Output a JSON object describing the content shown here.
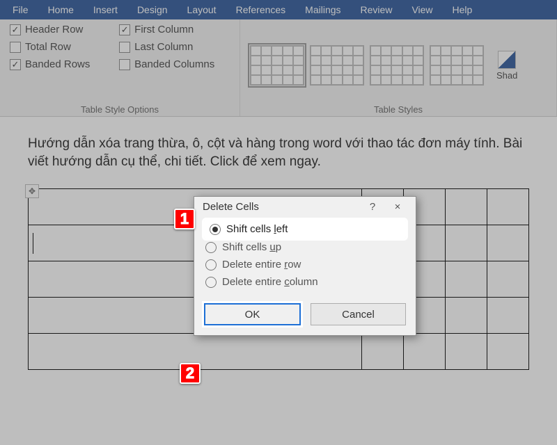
{
  "menu": {
    "file": "File",
    "home": "Home",
    "insert": "Insert",
    "design": "Design",
    "layout": "Layout",
    "references": "References",
    "mailings": "Mailings",
    "review": "Review",
    "view": "View",
    "help": "Help"
  },
  "style_options": {
    "header_row": "Header Row",
    "first_column": "First Column",
    "total_row": "Total Row",
    "last_column": "Last Column",
    "banded_rows": "Banded Rows",
    "banded_columns": "Banded Columns",
    "group_label": "Table Style Options"
  },
  "styles": {
    "group_label": "Table Styles",
    "shading": "Shad"
  },
  "doc": {
    "para": "Hướng dẫn xóa trang thừa, ô, cột và hàng trong word với thao tác đơn máy tính. Bài viết hướng dẫn cụ thể, chi tiết. Click để xem ngay."
  },
  "dialog": {
    "title": "Delete Cells",
    "opt1_pre": "Shift cells ",
    "opt1_u": "l",
    "opt1_post": "eft",
    "opt2_pre": "Shift cells ",
    "opt2_u": "u",
    "opt2_post": "p",
    "opt3_pre": "Delete entire ",
    "opt3_u": "r",
    "opt3_post": "ow",
    "opt4_pre": "Delete entire ",
    "opt4_u": "c",
    "opt4_post": "olumn",
    "ok": "OK",
    "cancel": "Cancel",
    "help": "?",
    "close": "×"
  },
  "annot": {
    "one": "1",
    "two": "2"
  }
}
